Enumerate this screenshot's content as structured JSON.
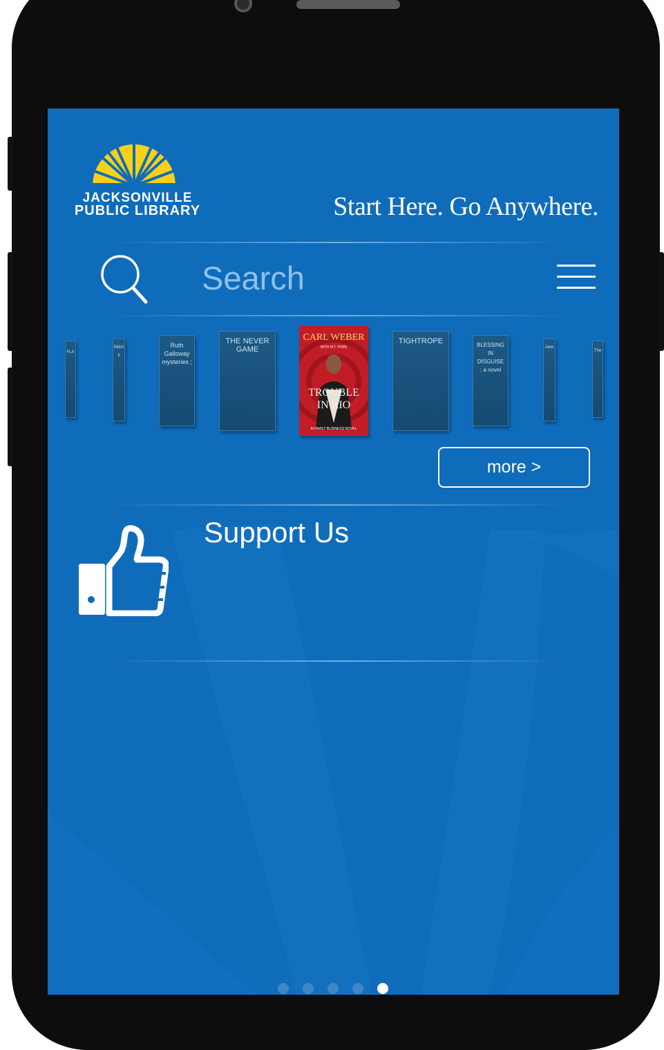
{
  "brand": {
    "logo_line1": "JACKSONVILLE",
    "logo_line2": "PUBLIC LIBRARY",
    "tagline": "Start Here. Go Anywhere.",
    "logo_sun_color": "#f7d117"
  },
  "search": {
    "placeholder": "Search",
    "icon": "search-icon"
  },
  "menu": {
    "icon": "hamburger-menu-icon"
  },
  "carousel": {
    "books": [
      {
        "title": "FLA"
      },
      {
        "title": "Stitch It"
      },
      {
        "title": "Ruth Galloway mysteries ;"
      },
      {
        "title": "THE NEVER GAME"
      },
      {
        "author": "CARL WEBER",
        "byline": "WITH M.T. POPE",
        "title": "TROUBLE IN RIO",
        "footer": "A FAMILY BUSINESS NOVEL"
      },
      {
        "title": "TIGHTROPE"
      },
      {
        "title": "BLESSING IN DISGUISE : a novel"
      },
      {
        "title": "Jane"
      },
      {
        "title": "The"
      }
    ],
    "more_label": "more >"
  },
  "support": {
    "label": "Support Us",
    "icon": "thumbs-up-icon"
  },
  "pager": {
    "count": 5,
    "active_index": 4
  },
  "colors": {
    "screen_bg": "#0f6cbb",
    "search_text": "#8fc1ea",
    "book_spine": "#1c5a86",
    "featured_cover": "#c8202a"
  }
}
